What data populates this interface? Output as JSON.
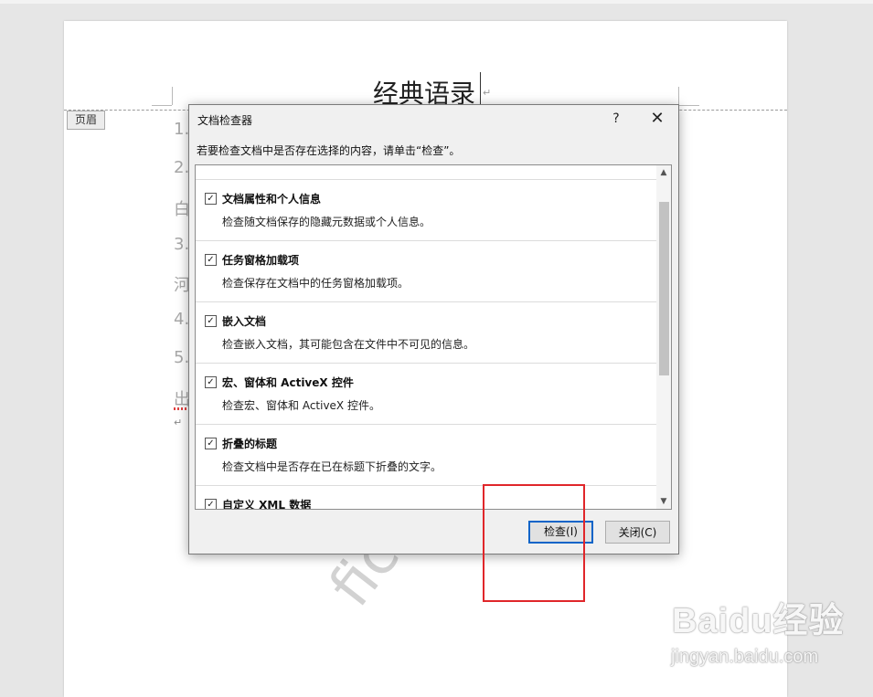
{
  "document": {
    "title": "经典语录",
    "header_tag": "页眉",
    "body_lines": [
      "1.",
      "2.",
      "白",
      "3.",
      "河",
      "4.",
      "5.",
      "出"
    ],
    "paragraph_mark": "↵",
    "watermark": "fice办"
  },
  "dialog": {
    "title": "文档检查器",
    "help_label": "?",
    "close_label": "✕",
    "instruction": "若要检查文档中是否存在选择的内容，请单击“检查”。",
    "items": [
      {
        "title": "文档属性和个人信息",
        "desc": "检查随文档保存的隐藏元数据或个人信息。",
        "checked": true
      },
      {
        "title": "任务窗格加载项",
        "desc": "检查保存在文档中的任务窗格加载项。",
        "checked": true
      },
      {
        "title": "嵌入文档",
        "desc": "检查嵌入文档，其可能包含在文件中不可见的信息。",
        "checked": true
      },
      {
        "title": "宏、窗体和 ActiveX 控件",
        "desc": "检查宏、窗体和 ActiveX 控件。",
        "checked": true
      },
      {
        "title": "折叠的标题",
        "desc": "检查文档中是否存在已在标题下折叠的文字。",
        "checked": true
      },
      {
        "title": "自定义 XML 数据",
        "desc": "",
        "checked": true
      }
    ],
    "check_mark": "✓",
    "inspect_button": "检查(I)",
    "close_button": "关闭(C)"
  },
  "watermark_site": {
    "logo": "Baidu经验",
    "url": "jingyan.baidu.com"
  },
  "colors": {
    "highlight_box": "#e0262a",
    "primary_button_border": "#0a64c8"
  }
}
